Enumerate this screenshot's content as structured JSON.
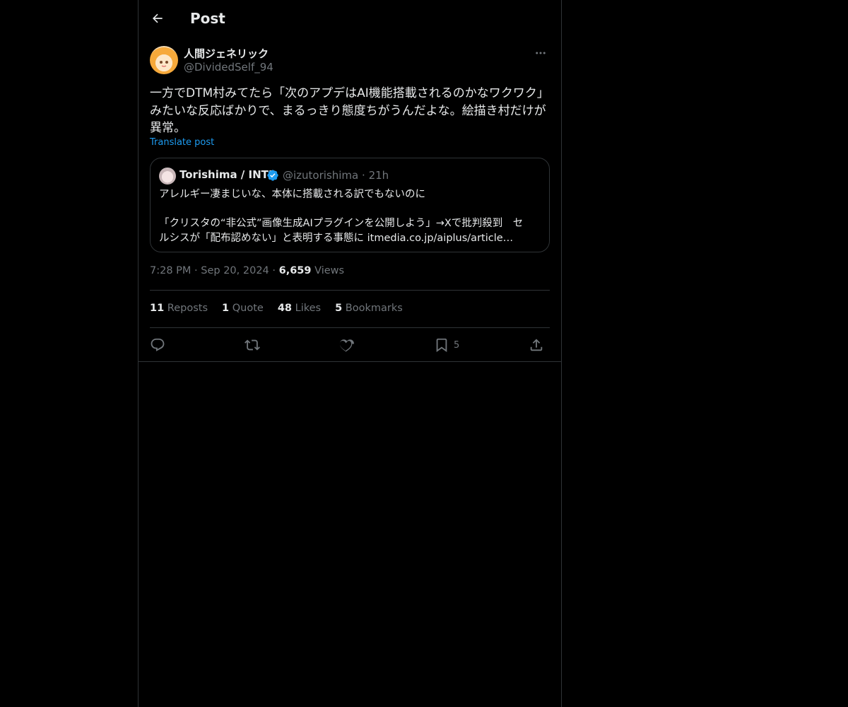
{
  "header": {
    "title": "Post"
  },
  "post": {
    "author": {
      "display_name": "人間ジェネリック",
      "handle": "@DividedSelf_94"
    },
    "text": "一方でDTM村みてたら「次のアプデはAI機能搭載されるのかなワクワク」\nみたいな反応ばかりで、まるっきり態度ちがうんだよな。絵描き村だけが\n異常。",
    "translate_label": "Translate post",
    "quote": {
      "display_name": "Torishima / INTP",
      "handle": "@izutorishima",
      "time": "21h",
      "text": "アレルギー凄まじいな、本体に搭載される訳でもないのに\n\n「クリスタの“非公式”画像生成AIプラグインを公開しよう」→Xで批判殺到　セ\nルシスが「配布認めない」と表明する事態に itmedia.co.jp/aiplus/article…"
    },
    "meta": {
      "time": "7:28 PM",
      "date": "Sep 20, 2024",
      "views_count": "6,659",
      "views_label": "Views"
    },
    "stats": {
      "reposts_count": "11",
      "reposts_label": "Reposts",
      "quote_count": "1",
      "quote_label": "Quote",
      "likes_count": "48",
      "likes_label": "Likes",
      "bookmarks_count": "5",
      "bookmarks_label": "Bookmarks"
    },
    "actions": {
      "reply_icon": "reply-icon",
      "repost_icon": "repost-icon",
      "like_icon": "heart-icon",
      "bookmark_icon": "bookmark-icon",
      "bookmark_count": "5",
      "share_icon": "share-icon"
    }
  },
  "colors": {
    "background": "#000000",
    "border": "#2f3336",
    "text": "#e7e9ea",
    "muted": "#71767b",
    "accent": "#1d9bf0"
  }
}
